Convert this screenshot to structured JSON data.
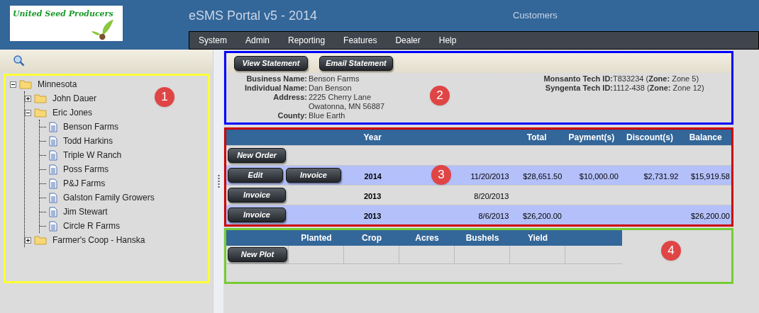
{
  "header": {
    "logo_text": "United Seed Producers",
    "title": "eSMS Portal v5 - 2014",
    "page": "Customers"
  },
  "menu": [
    "System",
    "Admin",
    "Reporting",
    "Features",
    "Dealer",
    "Help"
  ],
  "tree": [
    {
      "label": "Minnesota",
      "kind": "folder",
      "expanded": true,
      "children": [
        {
          "label": "John Dauer",
          "kind": "folder",
          "expanded": false
        },
        {
          "label": "Eric Jones",
          "kind": "folder",
          "expanded": true,
          "children": [
            {
              "label": "Benson Farms",
              "kind": "document"
            },
            {
              "label": "Todd Harkins",
              "kind": "document"
            },
            {
              "label": "Triple W Ranch",
              "kind": "document"
            },
            {
              "label": "Poss Farms",
              "kind": "document"
            },
            {
              "label": "P&J Farms",
              "kind": "document"
            },
            {
              "label": "Galston Family Growers",
              "kind": "document"
            },
            {
              "label": "Jim Stewart",
              "kind": "document"
            },
            {
              "label": "Circle R Farms",
              "kind": "document"
            }
          ]
        },
        {
          "label": "Farmer's Coop - Hanska",
          "kind": "folder",
          "expanded": false
        }
      ]
    }
  ],
  "statement_buttons": [
    "View Statement",
    "Email Statement"
  ],
  "details": [
    {
      "label": "Business Name:",
      "lines": [
        "Benson Farms"
      ]
    },
    {
      "label": "Individual Name:",
      "lines": [
        "Dan Benson"
      ]
    },
    {
      "label": "Address:",
      "lines": [
        "2225 Cherry Lane",
        "Owatonna, MN 56887"
      ]
    },
    {
      "label": "County:",
      "lines": [
        "Blue Earth"
      ]
    }
  ],
  "tech_ids": [
    {
      "label": "Monsanto Tech ID:",
      "value": "T833234 (**Zone:** Zone 5)"
    },
    {
      "label": "Syngenta Tech ID:",
      "value": "1112-438 (**Zone:** Zone 12)"
    }
  ],
  "orders": {
    "columns": [
      "Year",
      "",
      "Total",
      "Payment(s)",
      "Discount(s)",
      "Balance"
    ],
    "rows": [
      {
        "buttons": [
          "New Order"
        ],
        "cells": []
      },
      {
        "buttons": [
          "Edit",
          "Invoice"
        ],
        "cells": [
          "2014",
          "11/20/2013",
          "$28,651.50",
          "$10,000.00",
          "$2,731.92",
          "$15,919.58"
        ]
      },
      {
        "buttons": [
          "Invoice"
        ],
        "cells": [
          "2013",
          "8/20/2013",
          "",
          "",
          "",
          ""
        ]
      },
      {
        "buttons": [
          "Invoice"
        ],
        "cells": [
          "2013",
          "8/6/2013",
          "$26,200.00",
          "",
          "",
          "$26,200.00"
        ]
      }
    ]
  },
  "plots": {
    "columns": [
      "Planted",
      "Crop",
      "Acres",
      "Bushels",
      "Yield"
    ],
    "button": "New Plot"
  },
  "callouts": [
    {
      "number": "1",
      "color": "#ffff33"
    },
    {
      "number": "2",
      "color": "#0000ff"
    },
    {
      "number": "3",
      "color": "#cc0000"
    },
    {
      "number": "4",
      "color": "#77cc33"
    }
  ]
}
